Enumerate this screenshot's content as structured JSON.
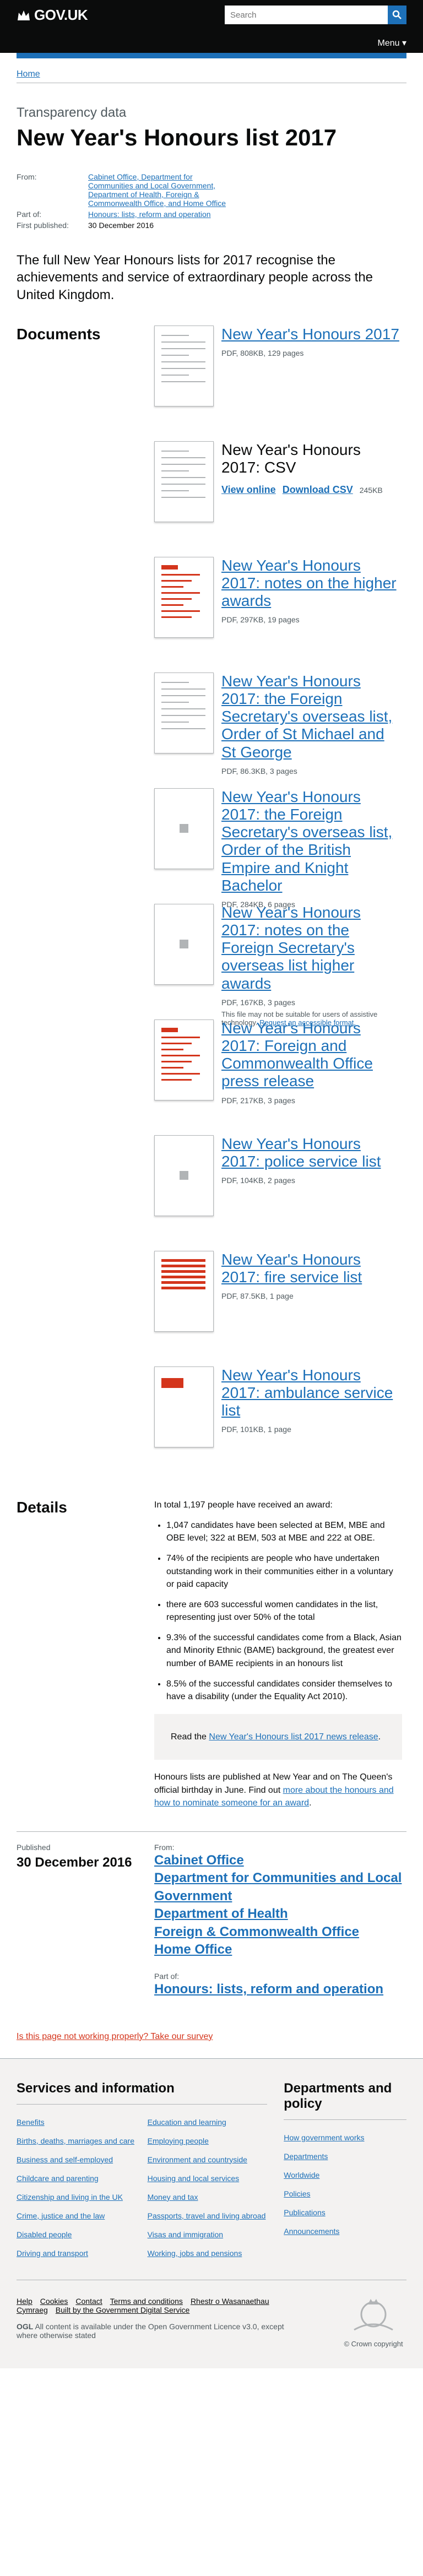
{
  "header": {
    "logo": "GOV.UK",
    "search_placeholder": "Search",
    "menu_label": "Menu ▾"
  },
  "breadcrumb": {
    "home": "Home"
  },
  "page": {
    "document_type": "Transparency data",
    "title": "New Year's Honours list 2017",
    "meta": {
      "from_label": "From:",
      "from_text": "Cabinet Office, Department for Communities and Local Government, Department of Health, Foreign & Commonwealth Office, and Home Office",
      "part_of_label": "Part of:",
      "part_of_text": "Honours: lists, reform and operation",
      "published_label": "First published:",
      "published_value": "30 December 2016"
    },
    "lede": "The full New Year Honours lists for 2017 recognise the achievements and service of extraordinary people across the United Kingdom."
  },
  "documents": {
    "heading": "Documents",
    "items": [
      {
        "title": "New Year's Honours 2017",
        "meta": "PDF, 808KB, 129 pages",
        "thumb": "lines"
      },
      {
        "title": "New Year's Honours 2017: CSV",
        "meta": "",
        "thumb": "table",
        "links": [
          "View online",
          "Download CSV"
        ],
        "size": "245KB"
      },
      {
        "title": "New Year's Honours 2017: notes on the higher awards",
        "meta": "PDF, 297KB, 19 pages",
        "thumb": "red"
      },
      {
        "title": "New Year's Honours 2017: the Foreign Secretary's overseas list, Order of St Michael and St George",
        "meta": "PDF, 86.3KB, 3 pages",
        "thumb": "lines"
      },
      {
        "title": "New Year's Honours 2017: the Foreign Secretary's overseas list, Order of the British Empire and Knight Bachelor",
        "meta": "PDF, 284KB, 6 pages",
        "thumb": "square"
      },
      {
        "title": "New Year's Honours 2017: notes on the Foreign Secretary's overseas list higher awards",
        "meta": "PDF, 167KB, 3 pages",
        "thumb": "square",
        "note": "This file may not be suitable for users of assistive technology.",
        "note_link": "Request an accessible format."
      },
      {
        "title": "New Year's Honours 2017: Foreign and Commonwealth Office press release",
        "meta": "PDF, 217KB, 3 pages",
        "thumb": "red"
      },
      {
        "title": "New Year's Honours 2017: police service list",
        "meta": "PDF, 104KB, 2 pages",
        "thumb": "square"
      },
      {
        "title": "New Year's Honours 2017: fire service list",
        "meta": "PDF, 87.5KB, 1 page",
        "thumb": "redtable"
      },
      {
        "title": "New Year's Honours 2017: ambulance service list",
        "meta": "PDF, 101KB, 1 page",
        "thumb": "redsmall"
      }
    ]
  },
  "details": {
    "heading": "Details",
    "intro": "In total 1,197 people have received an award:",
    "bullets": [
      "1,047 candidates have been selected at BEM, MBE and OBE level; 322 at BEM, 503 at MBE and 222 at OBE.",
      "74% of the recipients are people who have undertaken outstanding work in their communities either in a voluntary or paid capacity",
      "there are 603 successful women candidates in the list, representing just over 50% of the total",
      "9.3% of the successful candidates come from a Black, Asian and Minority Ethnic (BAME) background, the greatest ever number of BAME recipients in an honours list",
      "8.5% of the successful candidates consider themselves to have a disability (under the Equality Act 2010)."
    ],
    "callout_prefix": "Read the ",
    "callout_link": "New Year's Honours list 2017 news release",
    "callout_suffix": ".",
    "outro_text": "Honours lists are published at New Year and on The Queen's official birthday in June. Find out ",
    "outro_link": "more about the honours and how to nominate someone for an award",
    "outro_suffix": "."
  },
  "published": {
    "label": "Published",
    "date": "30 December 2016",
    "from_label": "From:",
    "orgs": [
      "Cabinet Office",
      "Department for Communities and Local Government",
      "Department of Health",
      "Foreign & Commonwealth Office",
      "Home Office"
    ],
    "part_of_label": "Part of:",
    "part_of": "Honours: lists, reform and operation"
  },
  "issue_link": "Is this page not working properly? Take our survey",
  "footer": {
    "services_heading": "Services and information",
    "services": [
      "Benefits",
      "Education and learning",
      "Births, deaths, marriages and care",
      "Employing people",
      "Business and self-employed",
      "Environment and countryside",
      "Childcare and parenting",
      "Housing and local services",
      "Citizenship and living in the UK",
      "Money and tax",
      "Crime, justice and the law",
      "Passports, travel and living abroad",
      "Disabled people",
      "Visas and immigration",
      "Driving and transport",
      "Working, jobs and pensions"
    ],
    "depts_heading": "Departments and policy",
    "depts": [
      "How government works",
      "Departments",
      "Worldwide",
      "Policies",
      "Publications",
      "Announcements"
    ],
    "meta_links": [
      "Help",
      "Cookies",
      "Contact",
      "Terms and conditions",
      "Rhestr o Wasanaethau Cymraeg",
      "Built by the Government Digital Service"
    ],
    "licence_prefix": "OGL",
    "licence": "All content is available under the Open Government Licence v3.0, except where otherwise stated",
    "crown": "© Crown copyright"
  },
  "colors": {
    "link": "#1d70b8",
    "header": "#0b0c0c",
    "alert": "#d4351c"
  }
}
